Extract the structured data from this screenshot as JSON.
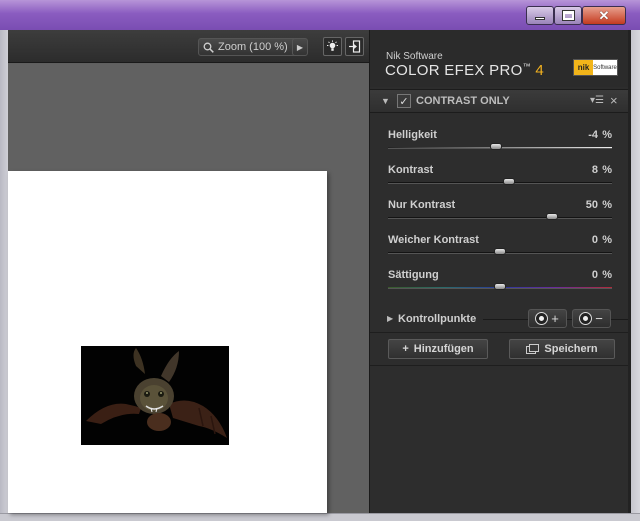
{
  "toolbar": {
    "zoom_label": "Zoom (100 %)",
    "zoom_icon": "magnifier-icon",
    "next_icon": "triangle-right-icon",
    "light_icon": "lightbulb-icon",
    "exit_icon": "exit-door-icon"
  },
  "window": {
    "minimize_icon": "minimize-icon",
    "maximize_icon": "maximize-icon",
    "close_icon": "close-icon"
  },
  "brand": {
    "company": "Nik Software",
    "product": "COLOR EFEX PRO",
    "tm": "™",
    "version": "4",
    "logo_nik": "nik",
    "logo_software": "Software"
  },
  "filter": {
    "title": "CONTRAST ONLY",
    "checked": "✓",
    "sliders": [
      {
        "label": "Helligkeit",
        "value": "-4",
        "unit": "%",
        "level": 0.48
      },
      {
        "label": "Kontrast",
        "value": "8",
        "unit": "%",
        "level": 0.54
      },
      {
        "label": "Nur Kontrast",
        "value": "50",
        "unit": "%",
        "level": 0.73
      },
      {
        "label": "Weicher Kontrast",
        "value": "0",
        "unit": "%",
        "level": 0.5
      },
      {
        "label": "Sättigung",
        "value": "0",
        "unit": "%",
        "level": 0.5
      }
    ]
  },
  "control_points": {
    "label": "Kontrollpunkte",
    "add_symbol": "+",
    "remove_symbol": "−"
  },
  "actions": {
    "add_label": "Hinzufügen",
    "add_symbol": "+",
    "save_label": "Speichern"
  },
  "colors": {
    "titlebar": "#8a5cc0",
    "panel": "#2d2d2d",
    "accent_version": "#f3b21f"
  }
}
